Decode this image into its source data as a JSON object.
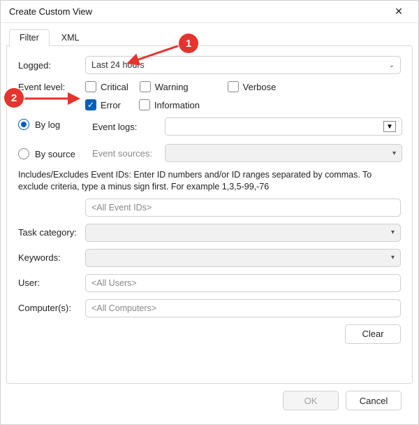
{
  "title": "Create Custom View",
  "tabs": {
    "filter": "Filter",
    "xml": "XML"
  },
  "logged": {
    "label": "Logged:",
    "value": "Last 24 hours"
  },
  "event_level": {
    "label": "Event level:",
    "critical": "Critical",
    "warning": "Warning",
    "verbose": "Verbose",
    "error": "Error",
    "information": "Information"
  },
  "mode": {
    "by_log": "By log",
    "by_source": "By source",
    "event_logs_label": "Event logs:",
    "event_sources_label": "Event sources:",
    "event_logs_value": "",
    "event_sources_value": ""
  },
  "id_text": "Includes/Excludes Event IDs: Enter ID numbers and/or ID ranges separated by commas. To exclude criteria, type a minus sign first. For example 1,3,5-99,-76",
  "event_ids_placeholder": "<All Event IDs>",
  "task_category": {
    "label": "Task category:",
    "value": ""
  },
  "keywords": {
    "label": "Keywords:",
    "value": ""
  },
  "user": {
    "label": "User:",
    "placeholder": "<All Users>"
  },
  "computers": {
    "label": "Computer(s):",
    "placeholder": "<All Computers>"
  },
  "buttons": {
    "clear": "Clear",
    "ok": "OK",
    "cancel": "Cancel"
  },
  "annotations": {
    "one": "1",
    "two": "2"
  }
}
